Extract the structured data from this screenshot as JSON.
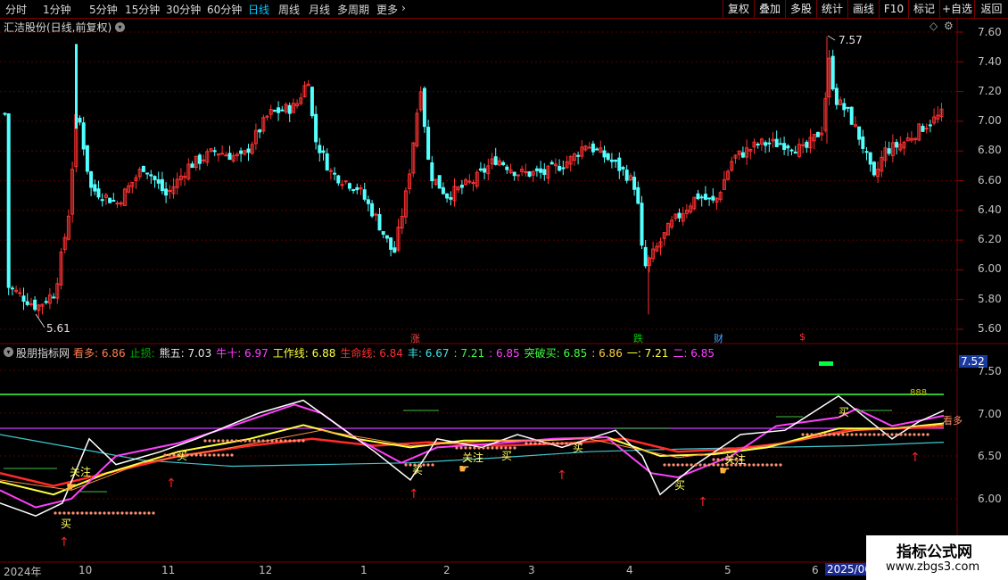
{
  "toolbar": {
    "timeframes": [
      "分时",
      "1分钟",
      "5分钟",
      "15分钟",
      "30分钟",
      "60分钟",
      "日线",
      "周线",
      "月线",
      "多周期",
      "更多"
    ],
    "active_timeframe": "日线",
    "right_buttons": [
      "复权",
      "叠加",
      "多股",
      "统计",
      "画线",
      "F10",
      "标记",
      "+自选",
      "返回"
    ]
  },
  "stock": {
    "title": "汇洁股份(日线,前复权)"
  },
  "price_chart": {
    "y_ticks": [
      "7.60",
      "7.40",
      "7.20",
      "7.00",
      "6.80",
      "6.60",
      "6.40",
      "6.20",
      "6.00",
      "5.80",
      "5.60"
    ],
    "high_label": "7.57",
    "low_label": "5.61",
    "event_markers": [
      {
        "text": "涨",
        "color": "#ff4040"
      },
      {
        "text": "跌",
        "color": "#00d000"
      },
      {
        "text": "财",
        "color": "#40a0ff"
      },
      {
        "text": "$",
        "color": "#ff3030"
      }
    ]
  },
  "indicator": {
    "name": "股朋指标网",
    "items": [
      {
        "label": "看多:",
        "value": "6.86",
        "color": "#ff7f50"
      },
      {
        "label": "止损:",
        "value": "",
        "color": "#00b000"
      },
      {
        "label": "熊五:",
        "value": "7.03",
        "color": "#e8e8e8"
      },
      {
        "label": "牛十:",
        "value": "6.97",
        "color": "#ff40ff"
      },
      {
        "label": "工作线:",
        "value": "6.88",
        "color": "#ffff40"
      },
      {
        "label": "生命线:",
        "value": "6.84",
        "color": "#ff3030"
      },
      {
        "label": "丰:",
        "value": "6.67",
        "color": "#40e0e0"
      },
      {
        "label": ":",
        "value": "7.21",
        "color": "#40ff40"
      },
      {
        "label": ":",
        "value": "6.85",
        "color": "#ff40ff"
      },
      {
        "label": "突破买:",
        "value": "6.85",
        "color": "#40ff40"
      },
      {
        "label": ":",
        "value": "6.86",
        "color": "#ffd040"
      },
      {
        "label": "一:",
        "value": "7.21",
        "color": "#ffff40"
      },
      {
        "label": "二:",
        "value": "6.85",
        "color": "#ff40ff"
      }
    ],
    "y_ticks": [
      "7.50",
      "7.00",
      "6.50",
      "6.00"
    ],
    "current_value": "7.52",
    "small_label": "888",
    "signal_buy": "买",
    "signal_attention": "关注",
    "signal_watch": "看多"
  },
  "x_axis": {
    "labels": [
      "2024年",
      "10",
      "11",
      "12",
      "1",
      "2",
      "3",
      "4",
      "5",
      "6",
      "2025/06"
    ]
  },
  "watermark": {
    "line1": "指标公式网",
    "line2": "www.zbgs3.com"
  },
  "colors": {
    "up": "#ff3232",
    "down": "#54ffff",
    "grid": "#7a0000"
  }
}
